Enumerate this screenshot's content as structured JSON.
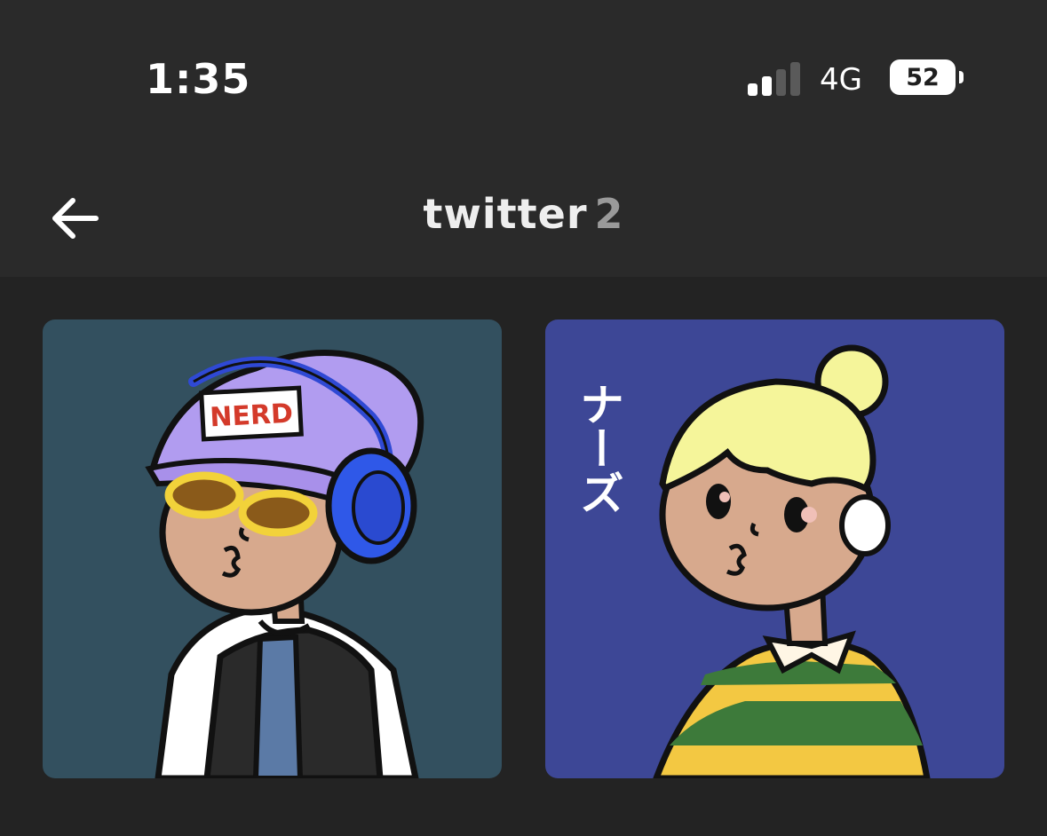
{
  "status_bar": {
    "time": "1:35",
    "network": "4G",
    "battery": "52",
    "signal_bars_active": 2,
    "signal_bars_total": 4
  },
  "header": {
    "title": "twitter",
    "count": "2"
  },
  "grid": {
    "items": [
      {
        "name": "nerd-avatar",
        "badge_text": "NERD",
        "background": "#33505f"
      },
      {
        "name": "blonde-avatar",
        "side_text": "ナーズ",
        "background": "#3d4796"
      }
    ]
  },
  "colors": {
    "page_bg": "#232323",
    "header_bg": "#2a2a2a",
    "title_count": "#9a9a9a"
  }
}
